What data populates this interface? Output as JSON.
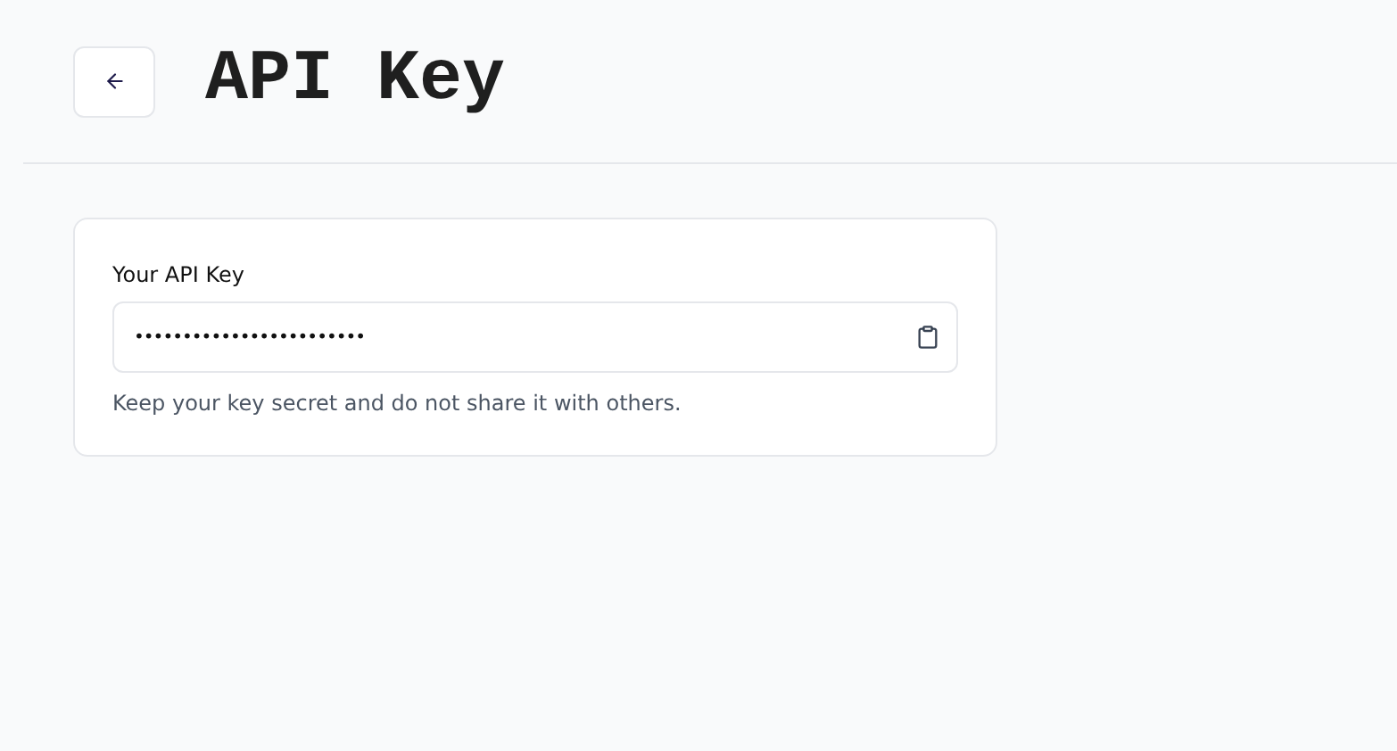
{
  "header": {
    "title": "API Key"
  },
  "api_key": {
    "label": "Your API Key",
    "value": "••••••••••••••••••••••••",
    "help": "Keep your key secret and do not share it with others."
  }
}
